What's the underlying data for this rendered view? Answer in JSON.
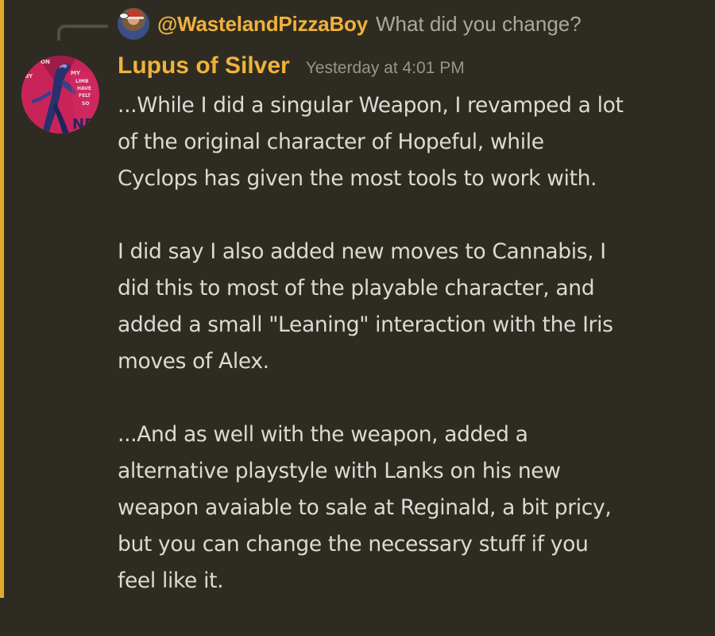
{
  "colors": {
    "background": "#2e2c22",
    "mention_highlight": "#e3a92a",
    "username": "#f0b23b",
    "body_text": "#dcdad3",
    "muted_text": "#96948c"
  },
  "reply": {
    "username": "@WastelandPizzaBoy",
    "preview_text": "What did you change?",
    "avatar_icon": "pizza-delivery-avatar-icon"
  },
  "message": {
    "author": "Lupus of Silver",
    "timestamp": "Yesterday at 4:01 PM",
    "avatar_icon": "silver-wolf-avatar-icon",
    "avatar_lettering": [
      "MY",
      "LIMB",
      "HAVE",
      "FELT",
      "SO",
      "BY",
      "ON",
      "NE"
    ],
    "paragraphs": [
      [
        "...While I did a singular Weapon, I revamped a lot",
        "of the original character of Hopeful, while",
        "Cyclops has given the most tools to work with."
      ],
      [
        "I did say I also added new moves to Cannabis, I",
        "did this to most of the playable character, and",
        "added a small \"Leaning\" interaction with the Iris",
        "moves of Alex."
      ],
      [
        "...And as well with the weapon, added a",
        "alternative playstyle with Lanks on his new",
        "weapon avaiable to sale at Reginald, a bit pricy,",
        "but you can change the necessary stuff if you",
        "feel like it."
      ]
    ]
  }
}
